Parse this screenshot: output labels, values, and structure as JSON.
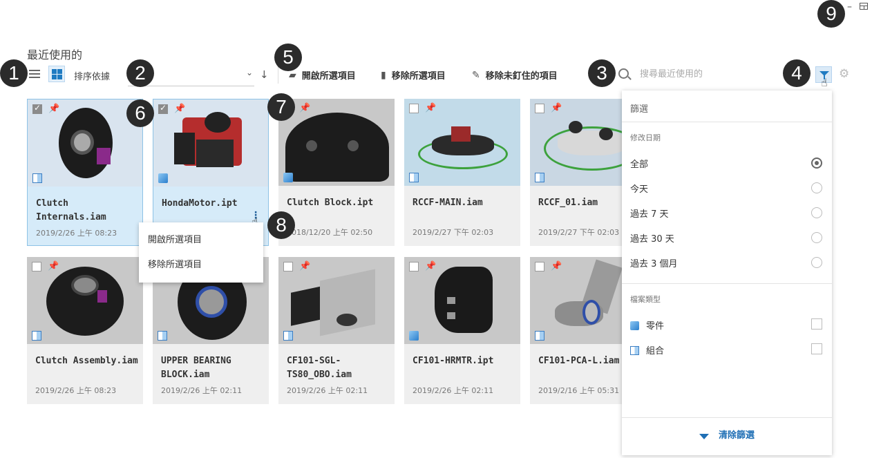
{
  "window": {
    "minimize": "–"
  },
  "section_title": "最近使用的",
  "toolbar": {
    "sort_label": "排序依據",
    "sort_value": "",
    "open_selected": "開啟所選項目",
    "remove_selected": "移除所選項目",
    "remove_unpinned": "移除未釘住的項目",
    "search_placeholder": "搜尋最近使用的"
  },
  "callouts": [
    "1",
    "2",
    "3",
    "4",
    "5",
    "6",
    "7",
    "8",
    "9"
  ],
  "cards": [
    {
      "name": "Clutch Internals.iam",
      "date": "2019/2/26 上午 08:23",
      "type": "assembly",
      "checked": true,
      "pinned": true,
      "selected": true
    },
    {
      "name": "HondaMotor.ipt",
      "date": "",
      "type": "part",
      "checked": true,
      "pinned": true,
      "selected": true
    },
    {
      "name": "Clutch Block.ipt",
      "date": "2018/12/20 上午 02:50",
      "type": "part",
      "checked": false,
      "pinned": true
    },
    {
      "name": "RCCF-MAIN.iam",
      "date": "2019/2/27 下午 02:03",
      "type": "assembly",
      "checked": false,
      "pinned": false
    },
    {
      "name": "RCCF_01.iam",
      "date": "2019/2/27 下午 02:03",
      "type": "assembly",
      "checked": false,
      "pinned": false
    },
    {
      "name": "Clutch Assembly.iam",
      "date": "2019/2/26 上午 08:23",
      "type": "assembly",
      "checked": false,
      "pinned": false
    },
    {
      "name": "UPPER BEARING BLOCK.iam",
      "date": "2019/2/26 上午 02:11",
      "type": "assembly",
      "checked": false,
      "pinned": false
    },
    {
      "name": "CF101-SGL-TS80_OBO.iam",
      "date": "2019/2/26 上午 02:11",
      "type": "assembly",
      "checked": false,
      "pinned": false
    },
    {
      "name": "CF101-HRMTR.ipt",
      "date": "2019/2/26 上午 02:11",
      "type": "part",
      "checked": false,
      "pinned": false
    },
    {
      "name": "CF101-PCA-L.iam",
      "date": "2019/2/16 上午 05:31",
      "type": "assembly",
      "checked": false,
      "pinned": false
    }
  ],
  "context_menu": {
    "items": [
      "開啟所選項目",
      "移除所選項目"
    ]
  },
  "filter_panel": {
    "title": "篩選",
    "date_heading": "修改日期",
    "date_options": [
      "全部",
      "今天",
      "過去 7 天",
      "過去 30 天",
      "過去 3 個月"
    ],
    "date_selected": "全部",
    "type_heading": "檔案類型",
    "type_options": [
      "零件",
      "組合"
    ],
    "clear_label": "清除篩選"
  },
  "colors": {
    "accent": "#1f7bc2",
    "selected_card": "#d6ebf9",
    "badge": "#2b2b2b"
  }
}
